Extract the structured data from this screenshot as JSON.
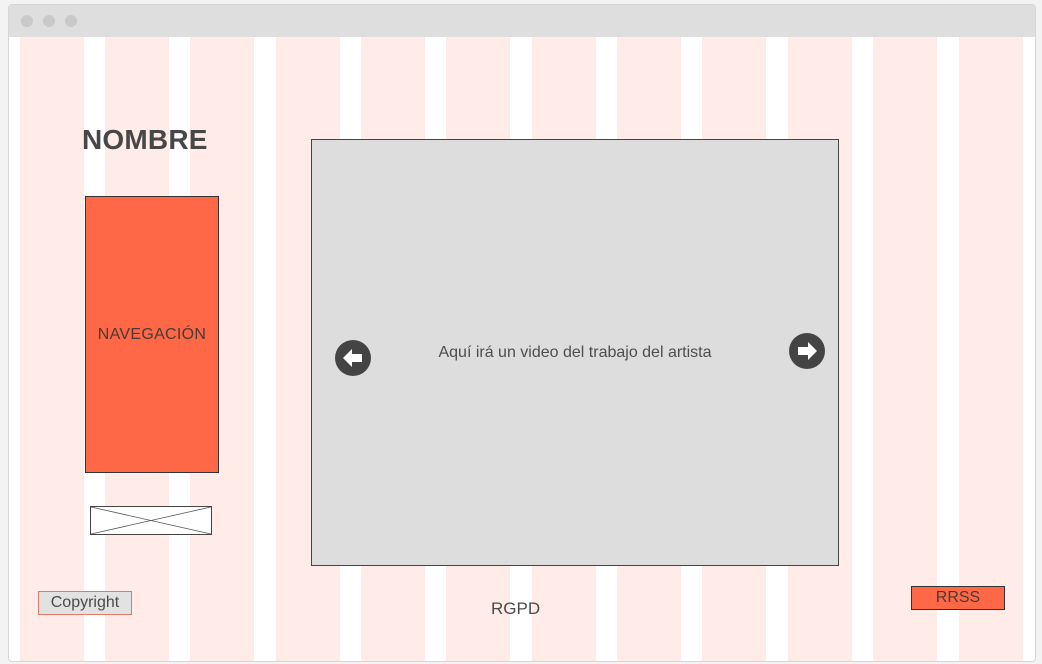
{
  "window": {
    "traffic_lights": [
      "close-dot",
      "minimize-dot",
      "maximize-dot"
    ]
  },
  "header": {
    "site_name": "NOMBRE"
  },
  "sidebar": {
    "nav_label": "NAVEGACIÓN",
    "image_placeholder_icon": "image-placeholder-icon"
  },
  "main": {
    "video_caption": "Aquí irá un video del trabajo del artista",
    "prev_icon": "arrow-left-circle-icon",
    "next_icon": "arrow-right-circle-icon"
  },
  "footer": {
    "copyright_label": "Copyright",
    "rgpd_label": "RGPD",
    "rrss_label": "RRSS"
  },
  "colors": {
    "grid_column": "#ffebe7",
    "accent": "#ff6847",
    "video_background": "#dddddd",
    "arrow_button": "#444444",
    "titlebar": "#dedede"
  }
}
